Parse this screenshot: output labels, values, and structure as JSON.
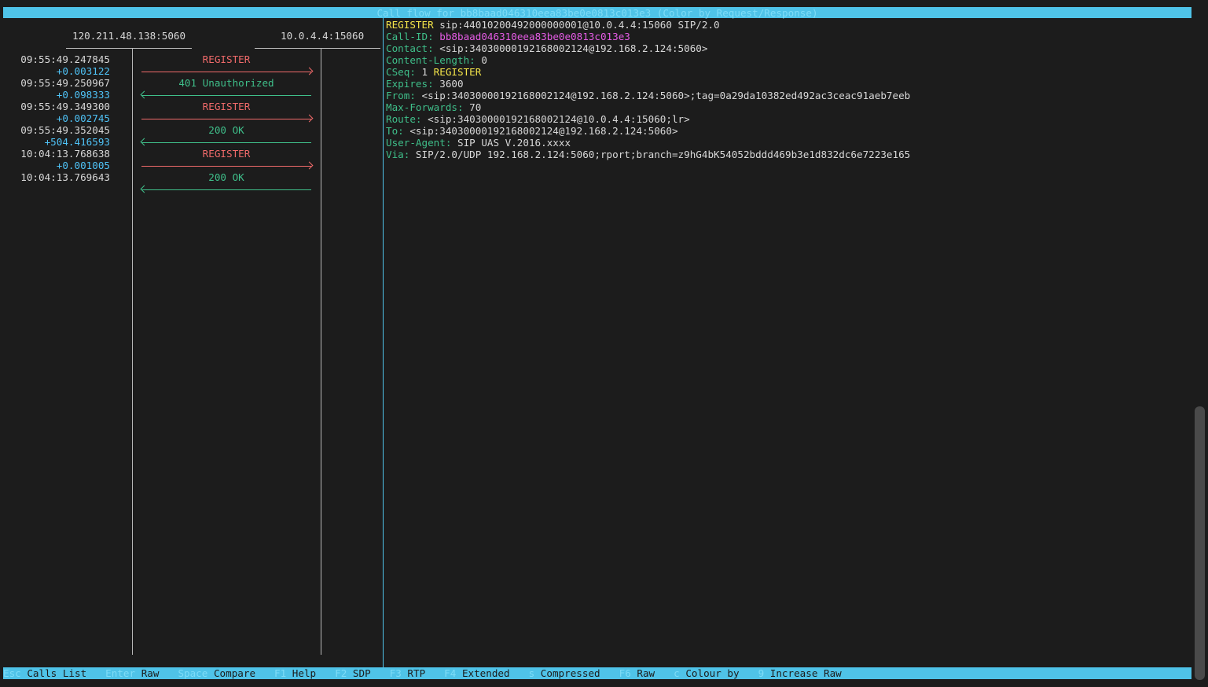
{
  "title": "Call flow for bb8baad046310eea83be0e0813c013e3 (Color by Request/Response)",
  "hosts": [
    "120.211.48.138:5060",
    "10.0.4.4:15060"
  ],
  "timestamps": [
    {
      "time": "09:55:49.247845",
      "delta": "+0.003122"
    },
    {
      "time": "09:55:49.250967",
      "delta": "+0.098333"
    },
    {
      "time": "09:55:49.349300",
      "delta": "+0.002745"
    },
    {
      "time": "09:55:49.352045",
      "delta": "+504.416593"
    },
    {
      "time": "10:04:13.768638",
      "delta": "+0.001005"
    },
    {
      "time": "10:04:13.769643",
      "delta": ""
    }
  ],
  "messages": [
    {
      "label": "REGISTER",
      "type": "request",
      "direction": "right"
    },
    {
      "label": "401 Unauthorized",
      "type": "response",
      "direction": "left"
    },
    {
      "label": "REGISTER",
      "type": "request",
      "direction": "right"
    },
    {
      "label": "200 OK",
      "type": "response",
      "direction": "left"
    },
    {
      "label": "REGISTER",
      "type": "request",
      "direction": "right"
    },
    {
      "label": "200 OK",
      "type": "response",
      "direction": "left"
    }
  ],
  "sip": {
    "request_method": "REGISTER",
    "request_uri": " sip:44010200492000000001@10.0.4.4:15060 SIP/2.0",
    "headers": [
      {
        "name": "Call-ID:",
        "value": " bb8baad046310eea83be0e0813c013e3",
        "cls": "callid"
      },
      {
        "name": "Contact:",
        "value": " <sip:34030000192168002124@192.168.2.124:5060>",
        "cls": "hval"
      },
      {
        "name": "Content-Length:",
        "value": " 0",
        "cls": "hval"
      },
      {
        "name": "CSeq:",
        "value": " 1 ",
        "cls": "hval",
        "extra": "REGISTER"
      },
      {
        "name": "Expires:",
        "value": " 3600",
        "cls": "hval"
      },
      {
        "name": "From:",
        "value": " <sip:34030000192168002124@192.168.2.124:5060>;tag=0a29da10382ed492ac3ceac91aeb7eeb",
        "cls": "hval"
      },
      {
        "name": "Max-Forwards:",
        "value": " 70",
        "cls": "hval"
      },
      {
        "name": "Route:",
        "value": " <sip:34030000192168002124@10.0.4.4:15060;lr>",
        "cls": "hval"
      },
      {
        "name": "To:",
        "value": " <sip:34030000192168002124@192.168.2.124:5060>",
        "cls": "hval"
      },
      {
        "name": "User-Agent:",
        "value": " SIP UAS V.2016.xxxx",
        "cls": "hval"
      },
      {
        "name": "Via:",
        "value": " SIP/2.0/UDP 192.168.2.124:5060;rport;branch=z9hG4bK54052bddd469b3e1d832dc6e7223e165",
        "cls": "hval"
      }
    ]
  },
  "keys": [
    {
      "key": "Esc",
      "action": "Calls List"
    },
    {
      "key": "Enter",
      "action": "Raw"
    },
    {
      "key": "Space",
      "action": "Compare"
    },
    {
      "key": "F1",
      "action": "Help"
    },
    {
      "key": "F2",
      "action": "SDP"
    },
    {
      "key": "F3",
      "action": "RTP"
    },
    {
      "key": "F4",
      "action": "Extended"
    },
    {
      "key": "s",
      "action": "Compressed"
    },
    {
      "key": "F6",
      "action": "Raw"
    },
    {
      "key": "c",
      "action": "Colour by"
    },
    {
      "key": "9",
      "action": "Increase Raw"
    }
  ],
  "colors": {
    "accent": "#4fc3e8",
    "request": "#f06a6a",
    "response": "#3fbf8a",
    "method": "#f5e64a",
    "callid": "#e65ce6"
  }
}
